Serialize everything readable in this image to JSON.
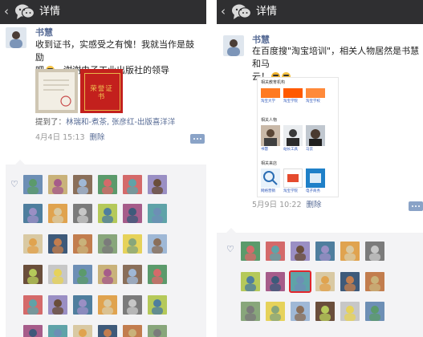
{
  "left": {
    "nav_title": "详情",
    "user_name": "书慧",
    "post_line1": "收到证书，实感受之有愧！我就当作是鼓励",
    "post_line2": "吧",
    "post_line2b": "。谢谢电子工业出版社的领导",
    "certificate_text": "荣誉证书",
    "mention_label": "提到了：",
    "mention_names": "林瑞和-煮茶, 张彦红-出版喜洋洋",
    "time": "4月4日 15:13",
    "delete_label": "删除"
  },
  "right": {
    "nav_title": "详情",
    "user_name": "书慧",
    "post_line1": "在百度搜\"淘宝培训\"，相关人物居然是书慧和马",
    "post_line2": "云！",
    "search_section1": "相关教育机构",
    "search_section2": "相关人物",
    "search_section3": "相关来店",
    "org_labels": [
      "淘宝大学",
      "淘宝学院",
      "淘宝学校"
    ],
    "person_labels": [
      "书慧",
      "站长工具",
      "马云"
    ],
    "store_labels": [
      "网络营销",
      "淘宝学院",
      "电子商务"
    ],
    "time": "5月9日 10:22",
    "delete_label": "删除"
  },
  "colors": {
    "nav_bg": "#2f2f31",
    "link_blue": "#576b95",
    "likes_bg": "#f3f3f5",
    "highlight_red": "#e0262d"
  },
  "icons": [
    "chevron-left-icon",
    "chat-bubbles-icon",
    "heart-icon",
    "comment-icon"
  ]
}
